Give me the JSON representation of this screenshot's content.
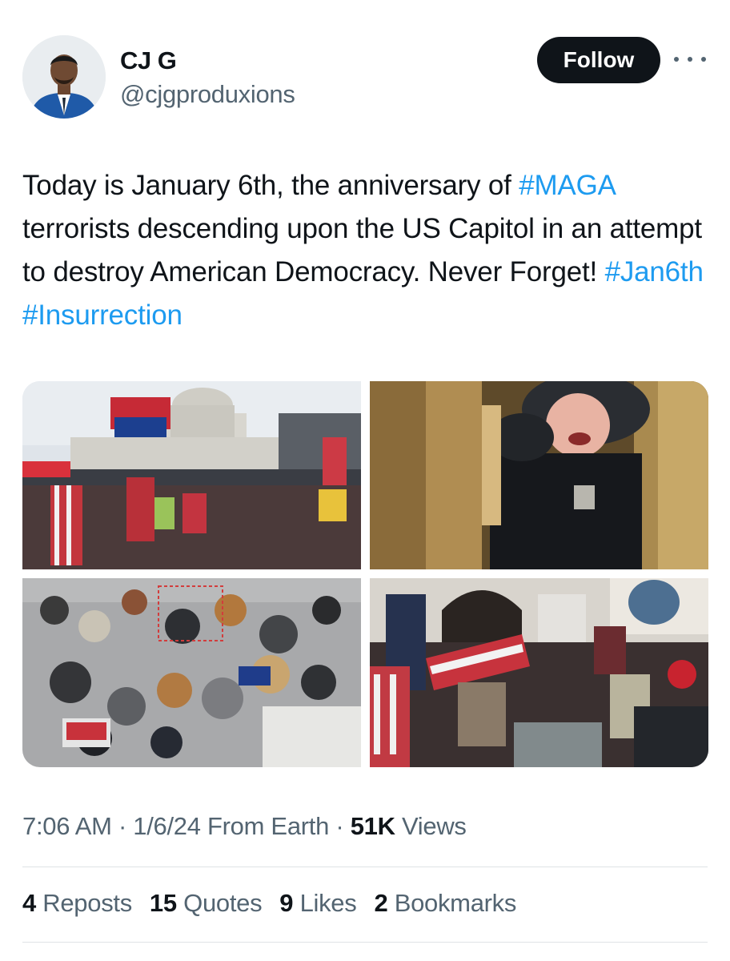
{
  "author": {
    "name": "CJ G",
    "handle": "@cjgproduxions"
  },
  "actions": {
    "follow_label": "Follow",
    "more_icon": "more-horizontal-icon"
  },
  "tweet": {
    "text_1": "Today is January 6th, the anniversary of ",
    "hashtag_1": "#MAGA",
    "text_2": " terrorists descending upon the US Capitol in an attempt to destroy American Democracy. Never Forget! ",
    "hashtag_2": "#Jan6th",
    "text_3": " ",
    "hashtag_3": "#Insurrection"
  },
  "meta": {
    "time": "7:06 AM",
    "sep1": " · ",
    "date": "1/6/24",
    "source": " From Earth",
    "sep2": " · ",
    "views_count": "51K",
    "views_label": " Views"
  },
  "stats": [
    {
      "count": "4",
      "label": "Reposts"
    },
    {
      "count": "15",
      "label": "Quotes"
    },
    {
      "count": "9",
      "label": "Likes"
    },
    {
      "count": "2",
      "label": "Bookmarks"
    }
  ],
  "colors": {
    "link": "#1d9bf0",
    "secondary_text": "#536471",
    "primary_text": "#0f1419",
    "button_bg": "#0f1419"
  }
}
